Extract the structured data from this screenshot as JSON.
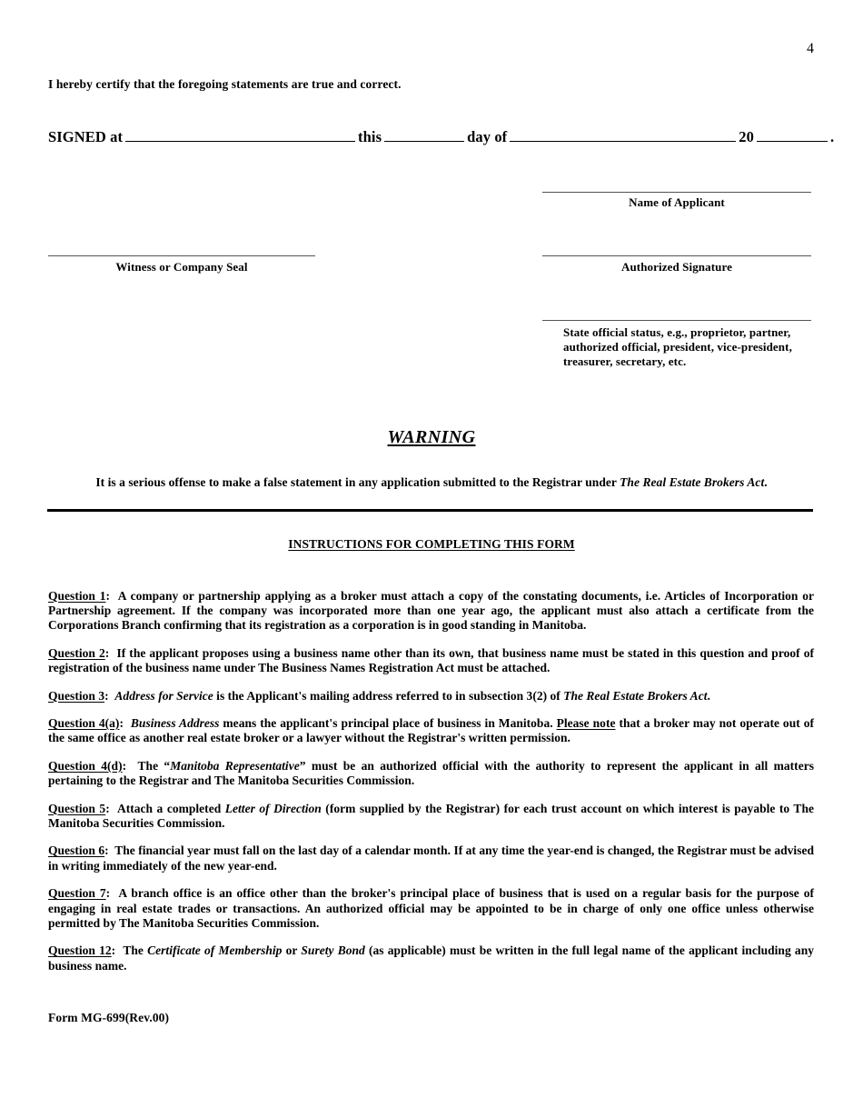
{
  "document": {
    "page_number": "4",
    "form_code": "Form MG-699(Rev.00)"
  },
  "certification": {
    "statement": "I hereby certify that the foregoing statements are true and correct."
  },
  "signed_line": {
    "signed_at_label": "SIGNED at",
    "this_label": "this",
    "day_of_label": "day of",
    "year_prefix": "20",
    "trailing_period": "."
  },
  "signature_blocks": {
    "name_of_applicant": "Name of Applicant",
    "witness_or_company_seal": "Witness or Company Seal",
    "authorized_signature": "Authorized Signature",
    "official_status": "State official status, e.g., proprietor, partner, authorized official, president, vice-president, treasurer, secretary, etc."
  },
  "warning": {
    "heading": "WARNING",
    "text_before_act": "It is a serious offense to make a false statement in any application submitted to the Registrar under ",
    "act_name": "The Real Estate Brokers Act",
    "text_after_act": "."
  },
  "instructions": {
    "heading": "INSTRUCTIONS FOR COMPLETING THIS FORM",
    "items": [
      {
        "label": "Question 1",
        "colon": ":",
        "body": "A company or partnership applying as a broker must attach a copy of the constating documents, i.e. Articles of Incorporation or Partnership agreement.  If the company was incorporated more than one year ago, the applicant must also attach a certificate from the Corporations Branch confirming that its registration as a corporation is in good standing in Manitoba."
      },
      {
        "label": "Question 2",
        "colon": ":",
        "body": "If the applicant proposes using a business name other than its own, that business name must be stated in this question and proof of registration of the business name under The Business Names Registration Act must be attached."
      },
      {
        "label": "Question 3",
        "colon": ":",
        "italic_lead": "Address for Service",
        "body_mid": " is the Applicant's mailing address referred to in subsection 3(2) of ",
        "italic_tail": "The Real Estate Brokers Act",
        "body_end": "."
      },
      {
        "label": "Question 4(a)",
        "colon": ":",
        "italic_lead": "Business Address",
        "body_mid": " means the applicant's principal place of business in Manitoba.  ",
        "underlined_phrase": "Please note",
        "body_end": " that a broker may not operate out of the same office as another real estate broker or a lawyer without the Registrar's written permission."
      },
      {
        "label": "Question 4(d)",
        "colon": ":",
        "body_lead": "The “",
        "italic_lead": "Manitoba Representative",
        "body_end": "” must be an authorized official with the authority to represent the applicant in all matters pertaining to the Registrar and The Manitoba Securities Commission."
      },
      {
        "label": "Question 5",
        "colon": ":",
        "body_lead": "Attach a completed ",
        "italic_lead": "Letter of Direction",
        "body_end": " (form supplied by the Registrar) for each trust account on which interest is payable to The Manitoba Securities Commission."
      },
      {
        "label": "Question 6",
        "colon": ":",
        "body": "The financial year must fall  on the last day of a calendar month.  If at any time the year-end is changed, the Registrar must be advised in writing immediately of the new year-end."
      },
      {
        "label": "Question 7",
        "colon": ":",
        "body": "A branch office is an office other than the broker's principal place of business that is used on a regular basis for the purpose of engaging in real estate trades or transactions.  An authorized official may be appointed to be in charge of only one office unless otherwise permitted by The Manitoba Securities Commission."
      },
      {
        "label": "Question 12",
        "colon": ":",
        "body_lead": "The ",
        "italic_lead": "Certificate of Membership",
        "body_mid": " or ",
        "italic_tail": "Surety Bond",
        "body_end": " (as applicable) must be written in the full legal name of the applicant including any business name."
      }
    ]
  }
}
